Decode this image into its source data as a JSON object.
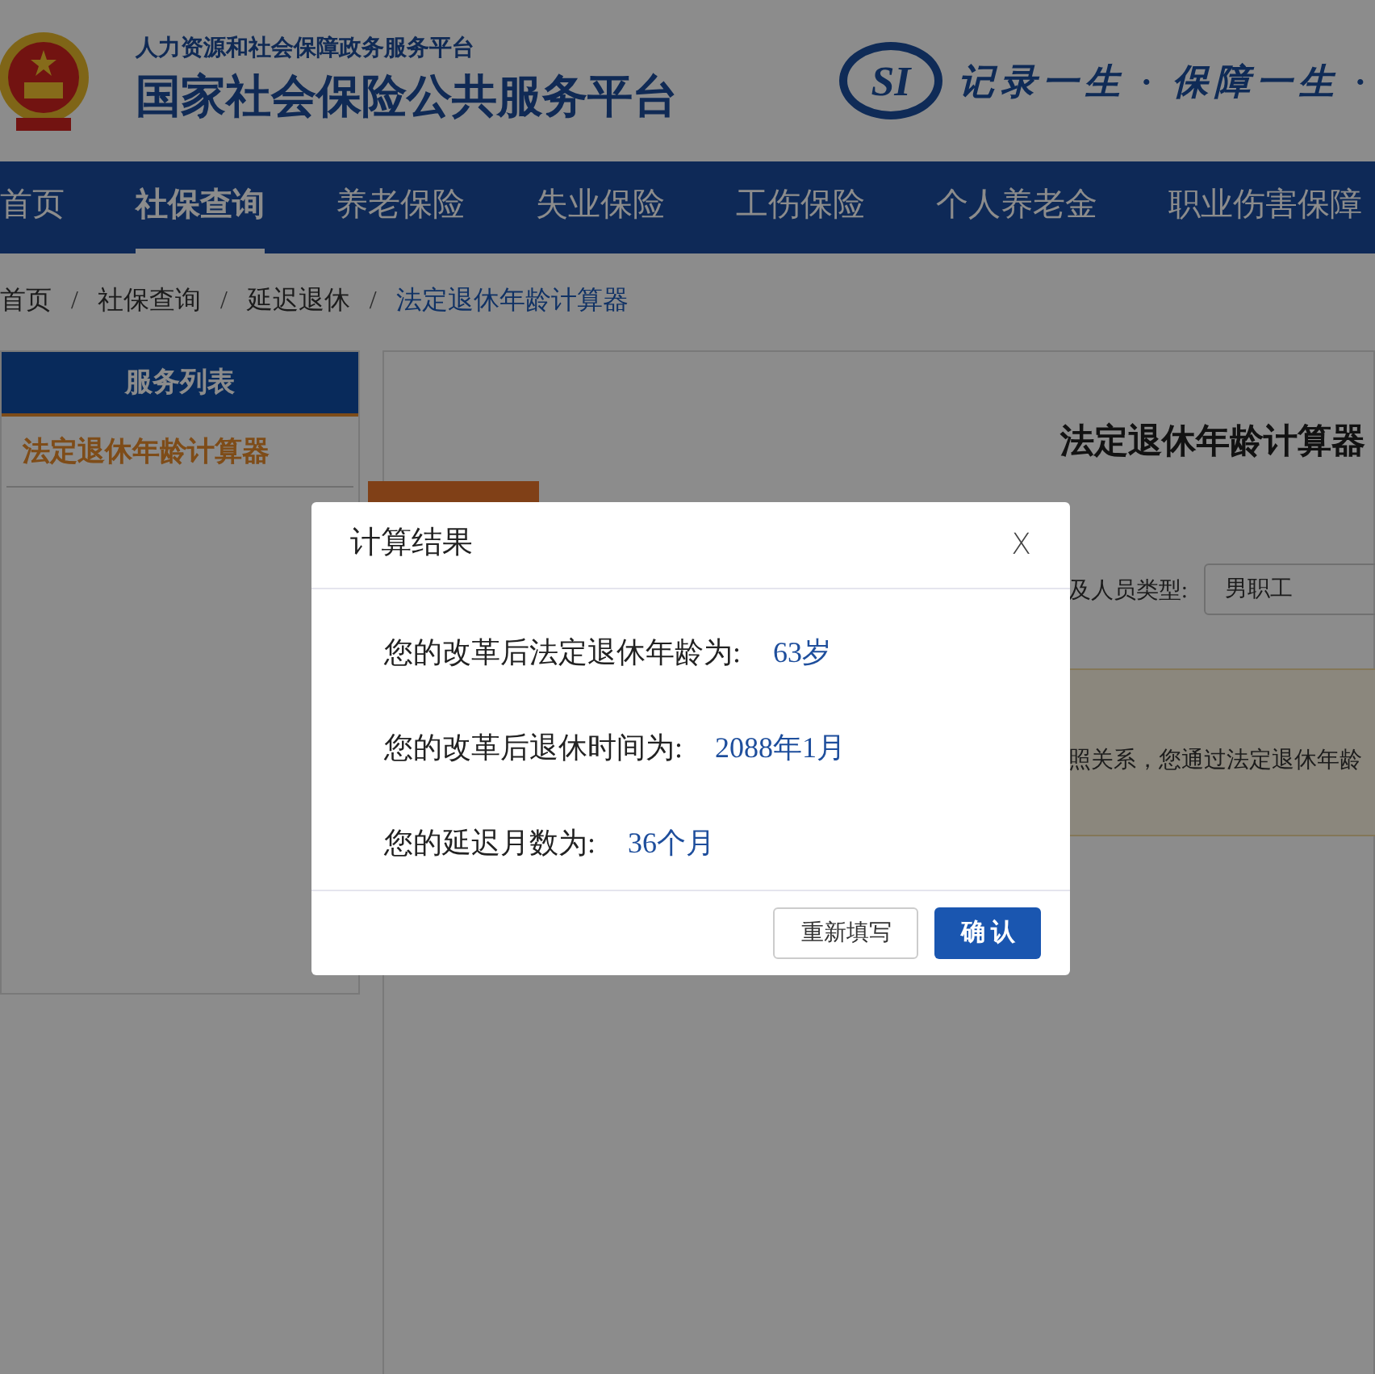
{
  "header": {
    "subtitle": "人力资源和社会保障政务服务平台",
    "title": "国家社会保险公共服务平台",
    "logo_text": "SI",
    "slogan": "记录一生 · 保障一生 ·"
  },
  "nav": [
    {
      "label": "首页",
      "selected": false
    },
    {
      "label": "社保查询",
      "selected": true
    },
    {
      "label": "养老保险",
      "selected": false
    },
    {
      "label": "失业保险",
      "selected": false
    },
    {
      "label": "工伤保险",
      "selected": false
    },
    {
      "label": "个人养老金",
      "selected": false
    },
    {
      "label": "职业伤害保障",
      "selected": false
    }
  ],
  "breadcrumb": [
    {
      "label": "首页",
      "selected": false
    },
    {
      "label": "社保查询",
      "selected": false
    },
    {
      "label": "延迟退休",
      "selected": false
    },
    {
      "label": "法定退休年龄计算器",
      "selected": true
    }
  ],
  "breadcrumb_separator": "/",
  "sidebar": {
    "title": "服务列表",
    "items": [
      {
        "label": "法定退休年龄计算器",
        "selected": true
      }
    ]
  },
  "main": {
    "title": "法定退休年龄计算器",
    "field_label": "及人员类型:",
    "field_value": "男职工",
    "notice": "照关系，您通过法定退休年龄"
  },
  "dialog": {
    "title": "计算结果",
    "close": "X",
    "results": [
      {
        "label": "您的改革后法定退休年龄为:",
        "value": "63岁"
      },
      {
        "label": "您的改革后退休时间为:",
        "value": "2088年1月"
      },
      {
        "label": "您的延迟月数为:",
        "value": "36个月"
      }
    ],
    "buttons": [
      {
        "label": "重新填写",
        "kind": "secondary"
      },
      {
        "label": "确 认",
        "kind": "primary"
      }
    ]
  }
}
